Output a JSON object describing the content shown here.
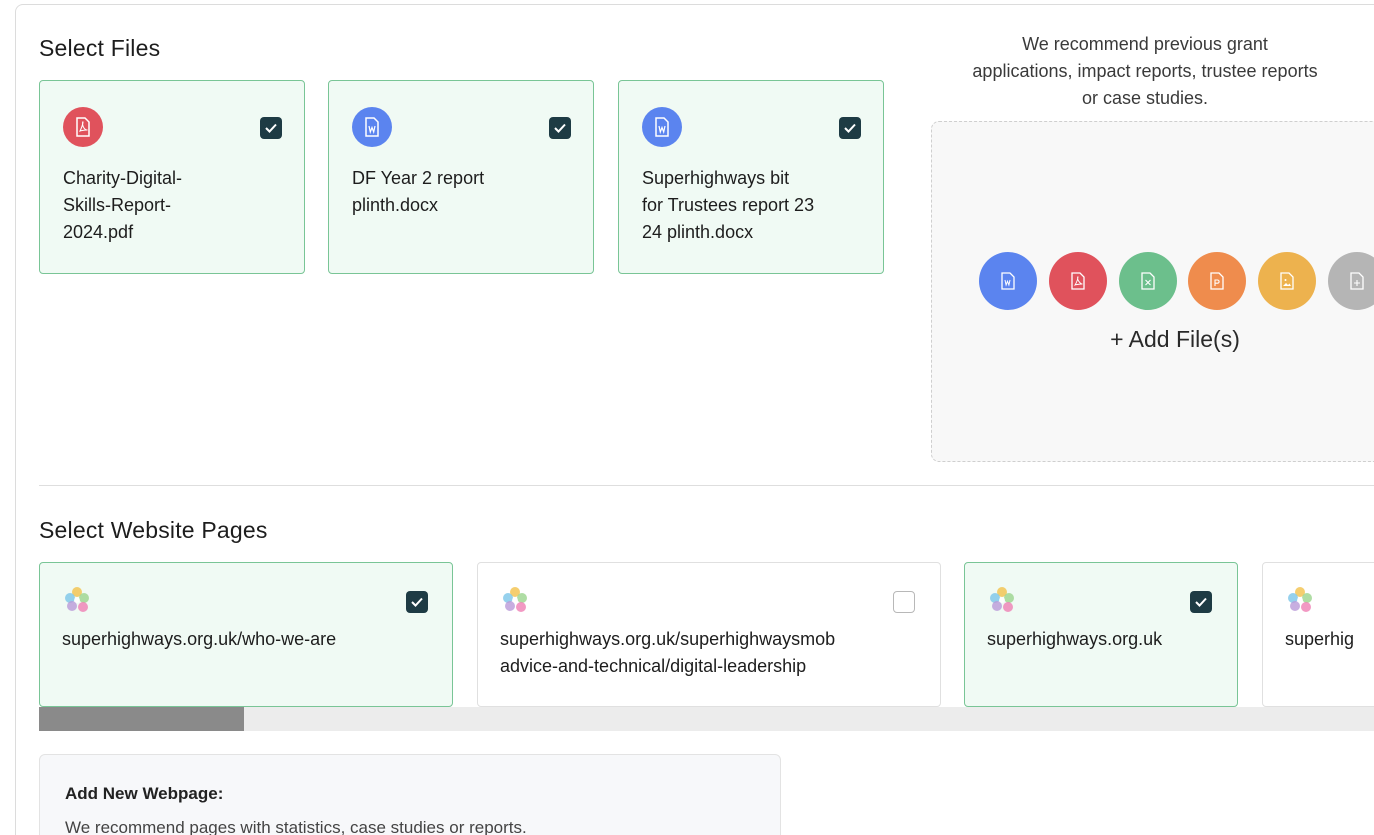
{
  "files_section": {
    "title": "Select Files",
    "files": [
      {
        "name": "Charity-Digital-Skills-Report-2024.pdf",
        "lines": [
          "Charity-Digital-",
          "Skills-Report-",
          "2024.pdf"
        ],
        "type": "pdf",
        "icon": "pdf-file-icon",
        "checked": true
      },
      {
        "name": "DF Year 2 report plinth.docx",
        "lines": [
          "DF Year 2 report",
          "plinth.docx"
        ],
        "type": "word",
        "icon": "word-file-icon",
        "checked": true
      },
      {
        "name": "Superhighways bit for Trustees report 23 24 plinth.docx",
        "lines": [
          "Superhighways bit",
          "for Trustees report 23",
          "24 plinth.docx"
        ],
        "type": "word",
        "icon": "word-file-icon",
        "checked": true
      }
    ]
  },
  "upload": {
    "recommend_lines": [
      "We recommend previous grant",
      "applications, impact reports, trustee reports",
      "or case studies."
    ],
    "add_label": "+ Add File(s)",
    "type_icons": [
      "word-icon",
      "pdf-icon",
      "excel-icon",
      "powerpoint-icon",
      "image-icon",
      "generic-file-icon"
    ]
  },
  "web_section": {
    "title": "Select Website Pages",
    "pages": [
      {
        "lines": [
          "superhighways.org.uk/who-we-are"
        ],
        "checked": true
      },
      {
        "lines": [
          "superhighways.org.uk/superhighwaysmob",
          "advice-and-technical/digital-leadership"
        ],
        "checked": false
      },
      {
        "lines": [
          "superhighways.org.uk"
        ],
        "checked": true
      },
      {
        "lines": [
          "superhig"
        ],
        "checked": false
      }
    ]
  },
  "add_webpage": {
    "title": "Add New Webpage:",
    "description": "We recommend pages with statistics, case studies or reports."
  },
  "colors": {
    "selected_bg": "#f0faf4",
    "selected_border": "#79c596",
    "checkbox": "#1e3b44",
    "word": "#5b84ef",
    "pdf": "#e0525c",
    "excel": "#6cbf8c",
    "powerpoint": "#ef8c4d",
    "image": "#edb24e",
    "generic": "#b5b5b5"
  }
}
